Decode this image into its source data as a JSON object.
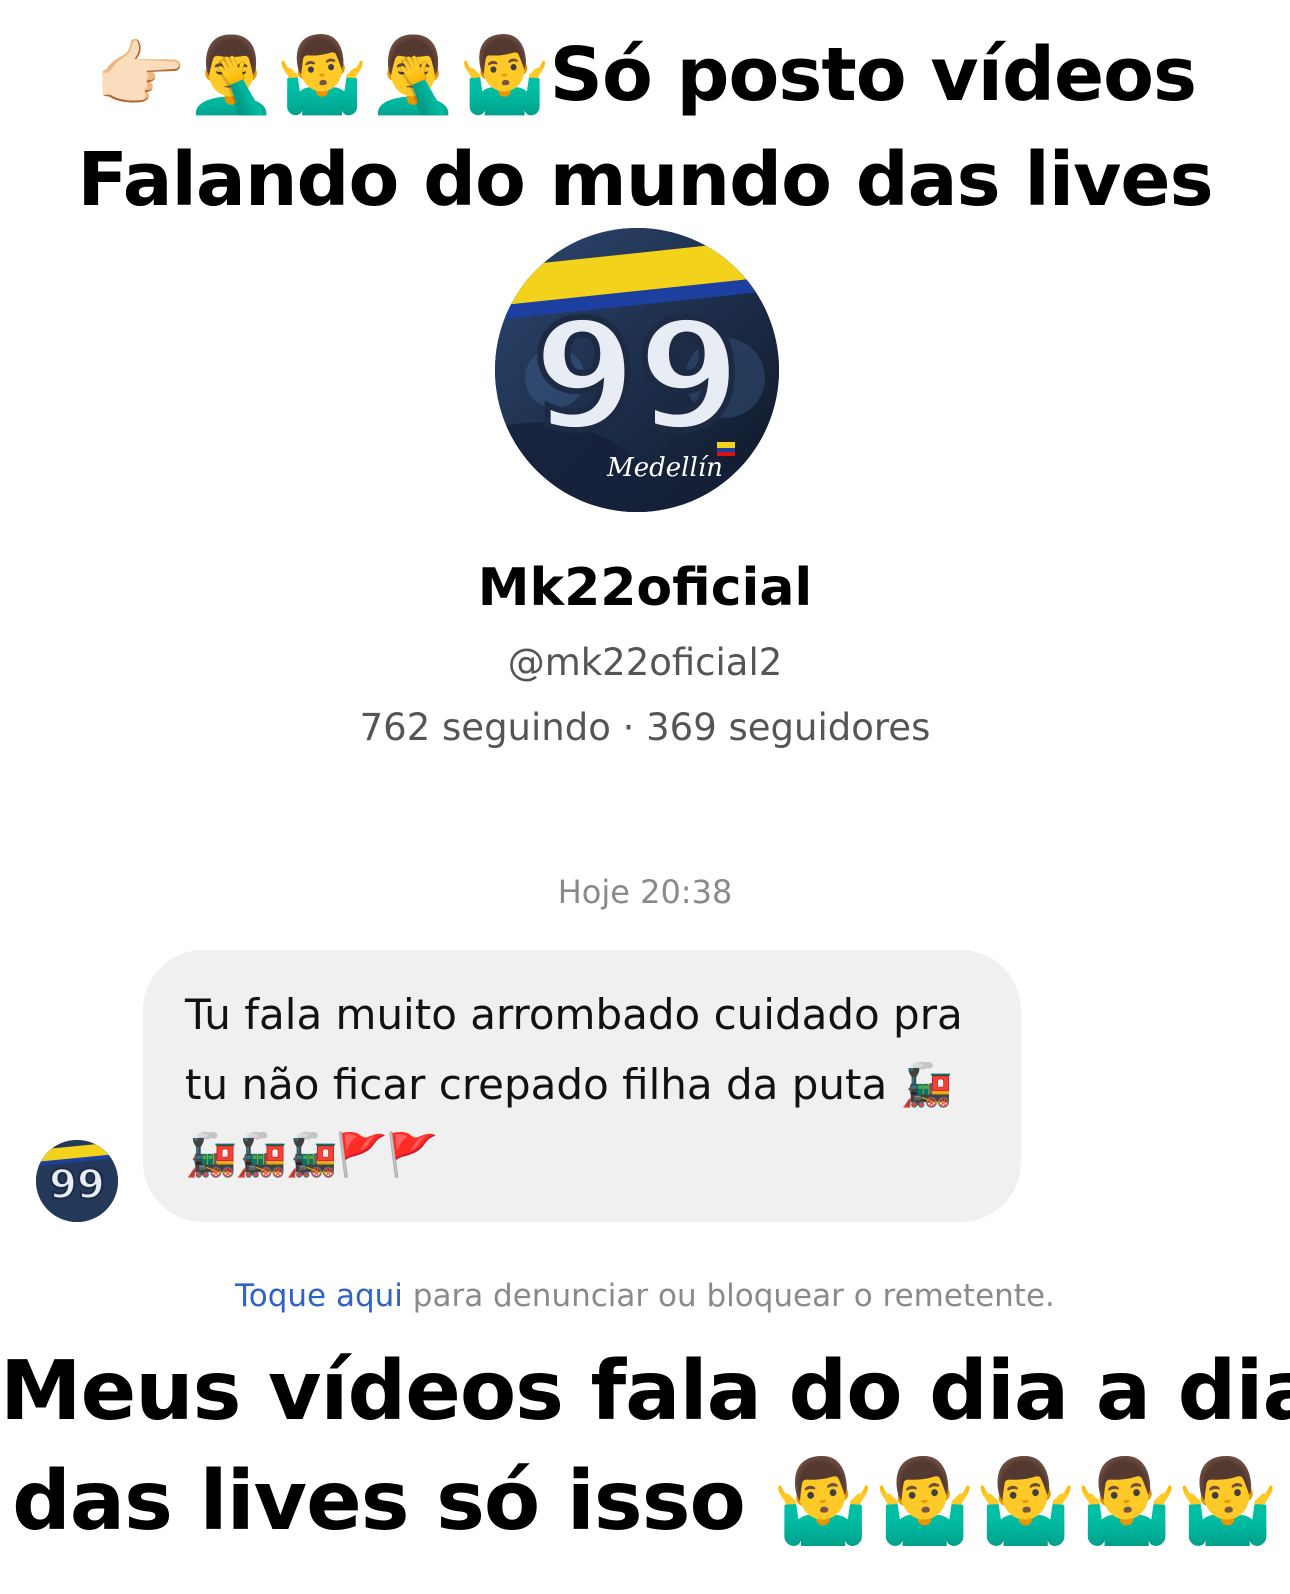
{
  "captions": {
    "top_line_1": "👉🏻🤦‍♂️🤷‍♂️🤦‍♂️🤷‍♂️Só posto vídeos",
    "top_line_2": "Falando do mundo das lives",
    "bottom_line_1": "Meus vídeos fala do dia a dia",
    "bottom_line_2": "das lives só isso 🤷‍♂️🤷‍♂️🤷‍♂️🤷‍♂️🤷‍♂️"
  },
  "profile": {
    "avatar_number": "99",
    "avatar_script": "Medellín",
    "name": "Mk22oficial",
    "handle": "@mk22oficial2",
    "stats": "762 seguindo · 369 seguidores"
  },
  "conversation": {
    "timestamp": "Hoje 20:38",
    "message_line_1": "Tu fala muito arrombado cuidado pra",
    "message_line_2": "tu não ficar crepado filha da puta 🚂",
    "message_line_3": "🚂🚂🚂🚩🚩"
  },
  "report": {
    "link": "Toque aqui",
    "text": " para denunciar ou bloquear o remetente."
  },
  "colors": {
    "link": "#2f63c7",
    "bubble": "#f0f0f0",
    "muted": "#8a8a8a"
  }
}
